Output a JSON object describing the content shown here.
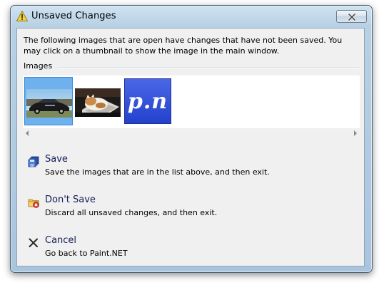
{
  "window": {
    "title": "Unsaved Changes",
    "title_icon": "warning-icon",
    "close_icon": "close-icon"
  },
  "description": "The following images that are open have changes that have not been saved. You may click on a thumbnail to show the image in the main window.",
  "images_group": {
    "label": "Images",
    "thumbnails": [
      {
        "name": "car-photo-thumbnail",
        "selected": true
      },
      {
        "name": "cat-keyboard-thumbnail",
        "selected": false
      },
      {
        "name": "pn-logo-thumbnail",
        "text": "p.n",
        "selected": false
      }
    ]
  },
  "commands": [
    {
      "icon": "save-icon",
      "title": "Save",
      "description": "Save the images that are in the list above, and then exit."
    },
    {
      "icon": "dont-save-icon",
      "title": "Don't Save",
      "description": "Discard all unsaved changes, and then exit."
    },
    {
      "icon": "cancel-x-icon",
      "title": "Cancel",
      "description": "Go back to Paint.NET"
    }
  ],
  "colors": {
    "accent_blue": "#6fb1ee",
    "command_title": "#151c55",
    "close_red": "#c0392b"
  }
}
